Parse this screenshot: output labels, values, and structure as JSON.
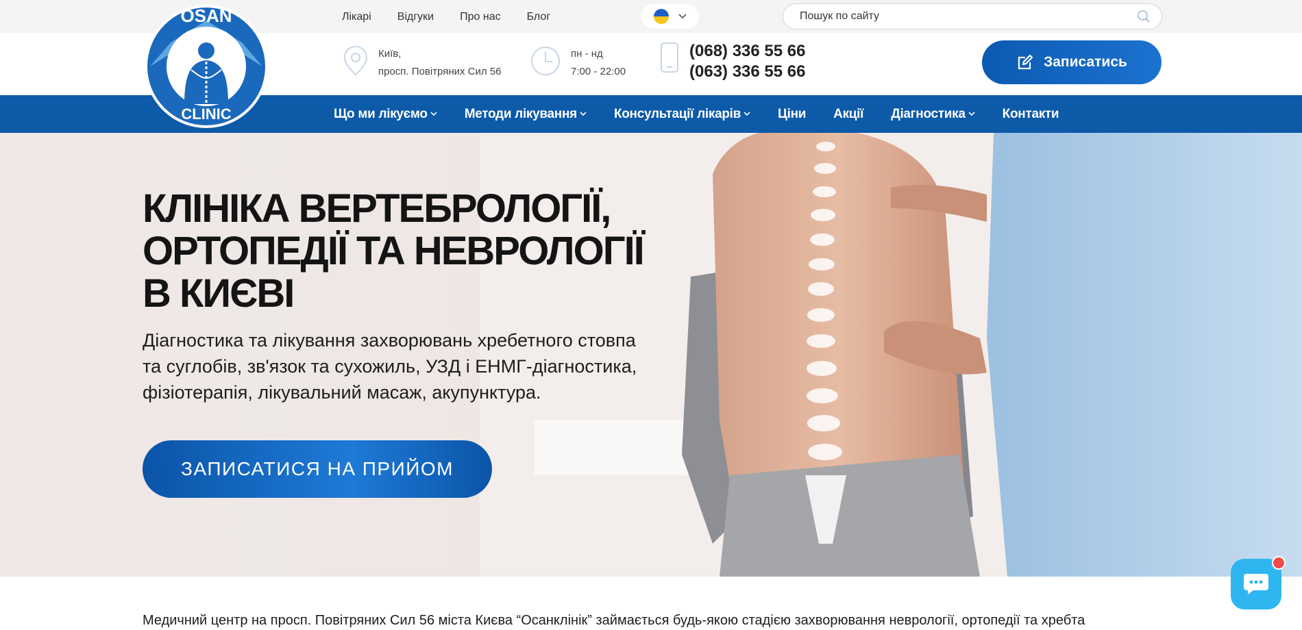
{
  "topbar": {
    "links": [
      "Лікарі",
      "Відгуки",
      "Про нас",
      "Блог"
    ],
    "search_placeholder": "Пошук по сайту"
  },
  "logo": {
    "top": "OSAN",
    "bottom": "CLINIC"
  },
  "contacts": {
    "address_line1": "Київ,",
    "address_line2": "просп. Повітряних Сил 56",
    "hours_line1": "пн - нд",
    "hours_line2": "7:00 - 22:00",
    "phone1": "(068) 336 55 66",
    "phone2": "(063) 336 55 66"
  },
  "book_button": "Записатись",
  "nav": [
    {
      "label": "Що ми лікуємо",
      "dropdown": true
    },
    {
      "label": "Методи лікування",
      "dropdown": true
    },
    {
      "label": "Консультації лікарів",
      "dropdown": true
    },
    {
      "label": "Ціни",
      "dropdown": false
    },
    {
      "label": "Акції",
      "dropdown": false
    },
    {
      "label": "Діагностика",
      "dropdown": true
    },
    {
      "label": "Контакти",
      "dropdown": false
    }
  ],
  "hero": {
    "title_line1": "КЛІНІКА ВЕРТЕБРОЛОГІЇ,",
    "title_line2": "ОРТОПЕДІЇ ТА НЕВРОЛОГІЇ",
    "title_line3": "В КИЄВІ",
    "lead_line1": "Діагностика та лікування захворювань хребетного стовпа",
    "lead_line2": "та суглобів, зв'язок та сухожиль, УЗД і ЕНМГ-діагностика,",
    "lead_line3": "фізіотерапія, лікувальний масаж, акупунктура.",
    "cta": "ЗАПИСАТИСЯ НА ПРИЙОМ"
  },
  "intro_text": "Медичний центр на просп. Повітряних Сил 56 міста Києва “Осанклінік” займається будь-якою стадією захворювання неврології, ортопедії та хребта",
  "colors": {
    "brand_blue": "#0c5aa8",
    "chat_blue": "#2fb6f0",
    "hero_bg": "#efe8e6"
  }
}
